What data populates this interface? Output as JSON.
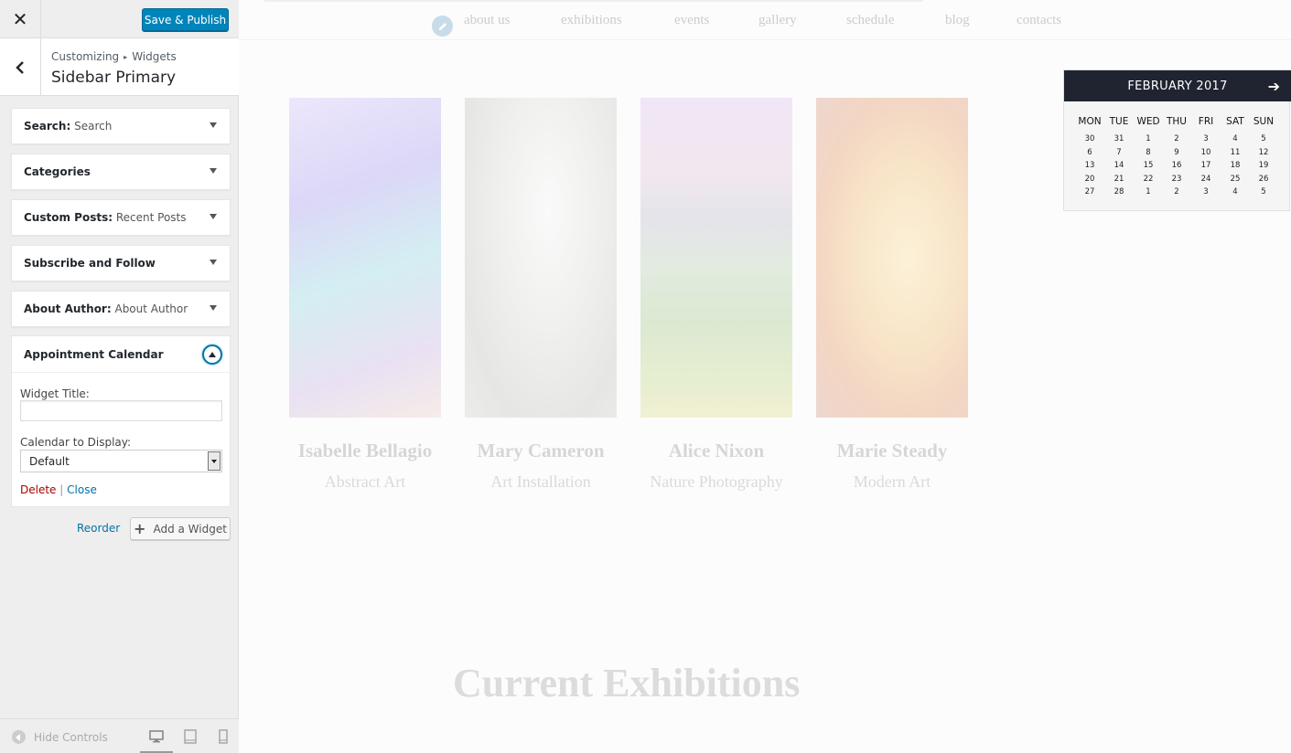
{
  "sidebar": {
    "close_glyph": "✕",
    "save_label": "Save & Publish",
    "breadcrumb": [
      "Customizing",
      "Widgets"
    ],
    "section_title": "Sidebar Primary",
    "widgets": [
      {
        "name": "Search:",
        "instance": "Search"
      },
      {
        "name": "Categories",
        "instance": ""
      },
      {
        "name": "Custom Posts:",
        "instance": "Recent Posts"
      },
      {
        "name": "Subscribe and Follow",
        "instance": ""
      },
      {
        "name": "About Author:",
        "instance": "About Author"
      }
    ],
    "open_widget": {
      "title": "Appointment Calendar",
      "widget_title_label": "Widget Title:",
      "widget_title_value": "",
      "calendar_label": "Calendar to Display:",
      "calendar_value": "Default",
      "delete_label": "Delete",
      "separator": "|",
      "close_label": "Close"
    },
    "reorder_label": "Reorder",
    "add_widget_label": "Add a Widget",
    "hide_controls_label": "Hide Controls",
    "devices": [
      "desktop-icon",
      "tablet-icon",
      "mobile-icon"
    ]
  },
  "preview": {
    "nav": [
      "about us",
      "exhibitions",
      "events",
      "gallery",
      "schedule",
      "blog",
      "contacts"
    ],
    "artists": [
      {
        "name": "Isabelle Bellagio",
        "discipline": "Abstract Art"
      },
      {
        "name": "Mary Cameron",
        "discipline": "Art Installation"
      },
      {
        "name": "Alice Nixon",
        "discipline": "Nature Photography"
      },
      {
        "name": "Marie Steady",
        "discipline": "Modern Art"
      }
    ],
    "section_heading": "Current Exhibitions",
    "calendar": {
      "month_label": "FEBRUARY 2017",
      "next_glyph": "➔",
      "weekdays": [
        "MON",
        "TUE",
        "WED",
        "THU",
        "FRI",
        "SAT",
        "SUN"
      ],
      "weeks": [
        [
          "30",
          "31",
          "1",
          "2",
          "3",
          "4",
          "5"
        ],
        [
          "6",
          "7",
          "8",
          "9",
          "10",
          "11",
          "12"
        ],
        [
          "13",
          "14",
          "15",
          "16",
          "17",
          "18",
          "19"
        ],
        [
          "20",
          "21",
          "22",
          "23",
          "24",
          "25",
          "26"
        ],
        [
          "27",
          "28",
          "1",
          "2",
          "3",
          "4",
          "5"
        ]
      ]
    }
  },
  "colors": {
    "primary_button": "#0085ba",
    "link": "#0073aa",
    "delete": "#a00",
    "calendar_header": "#1f2430"
  }
}
